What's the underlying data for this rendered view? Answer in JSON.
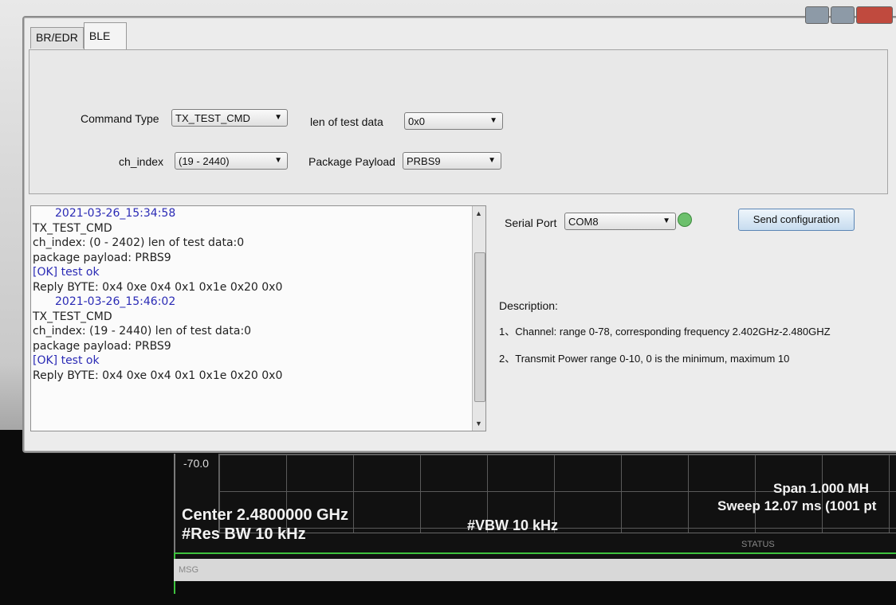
{
  "analyzer": {
    "y_label": "-70.0",
    "center": "Center 2.4800000 GHz",
    "res_bw": "#Res BW 10 kHz",
    "vbw": "#VBW 10 kHz",
    "span": "Span 1.000 MH",
    "sweep": "Sweep  12.07 ms (1001 pt",
    "status": "STATUS",
    "msg": "MSG"
  },
  "tabs": [
    {
      "label": "BR/EDR"
    },
    {
      "label": "BLE"
    }
  ],
  "config": {
    "command_type_label": "Command Type",
    "command_type_value": "TX_TEST_CMD",
    "len_label": "len of test data",
    "len_value": "0x0",
    "ch_index_label": "ch_index",
    "ch_index_value": "(19 - 2440)",
    "payload_label": "Package Payload",
    "payload_value": "PRBS9"
  },
  "log": [
    {
      "type": "ts",
      "text": "2021-03-26_15:34:58"
    },
    {
      "type": "text",
      "text": "TX_TEST_CMD"
    },
    {
      "type": "text",
      "text": "ch_index: (0 - 2402)  len of test data:0"
    },
    {
      "type": "text",
      "text": "package payload: PRBS9"
    },
    {
      "type": "ok",
      "text": "[OK] test ok"
    },
    {
      "type": "text",
      "text": "Reply BYTE: 0x4 0xe 0x4 0x1 0x1e 0x20 0x0"
    },
    {
      "type": "ts",
      "text": "2021-03-26_15:46:02"
    },
    {
      "type": "text",
      "text": "TX_TEST_CMD"
    },
    {
      "type": "text",
      "text": "ch_index: (19 - 2440)  len of test data:0"
    },
    {
      "type": "text",
      "text": "package payload: PRBS9"
    },
    {
      "type": "ok",
      "text": "[OK] test ok"
    },
    {
      "type": "text",
      "text": "Reply BYTE: 0x4 0xe 0x4 0x1 0x1e 0x20 0x0"
    }
  ],
  "serial": {
    "label": "Serial Port",
    "value": "COM8",
    "send_label": "Send configuration"
  },
  "description": {
    "title": "Description:",
    "items": [
      "1、Channel: range 0-78, corresponding frequency 2.402GHz-2.480GHZ",
      "2、Transmit Power  range 0-10, 0 is the minimum, maximum 10"
    ]
  }
}
